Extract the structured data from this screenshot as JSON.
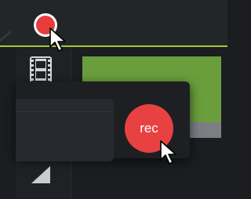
{
  "toolbar": {
    "record_icon": "record-dot-icon"
  },
  "sidebar": {
    "items": [
      {
        "icon": "film-strip-icon"
      },
      {
        "icon": "media-icon"
      }
    ]
  },
  "popup": {
    "rec_label": "rec"
  },
  "colors": {
    "accent_green": "#9fc93c",
    "record_red": "#e84141",
    "preview_green": "#6a9e3c"
  },
  "cursor_icon": "arrow-cursor-icon"
}
